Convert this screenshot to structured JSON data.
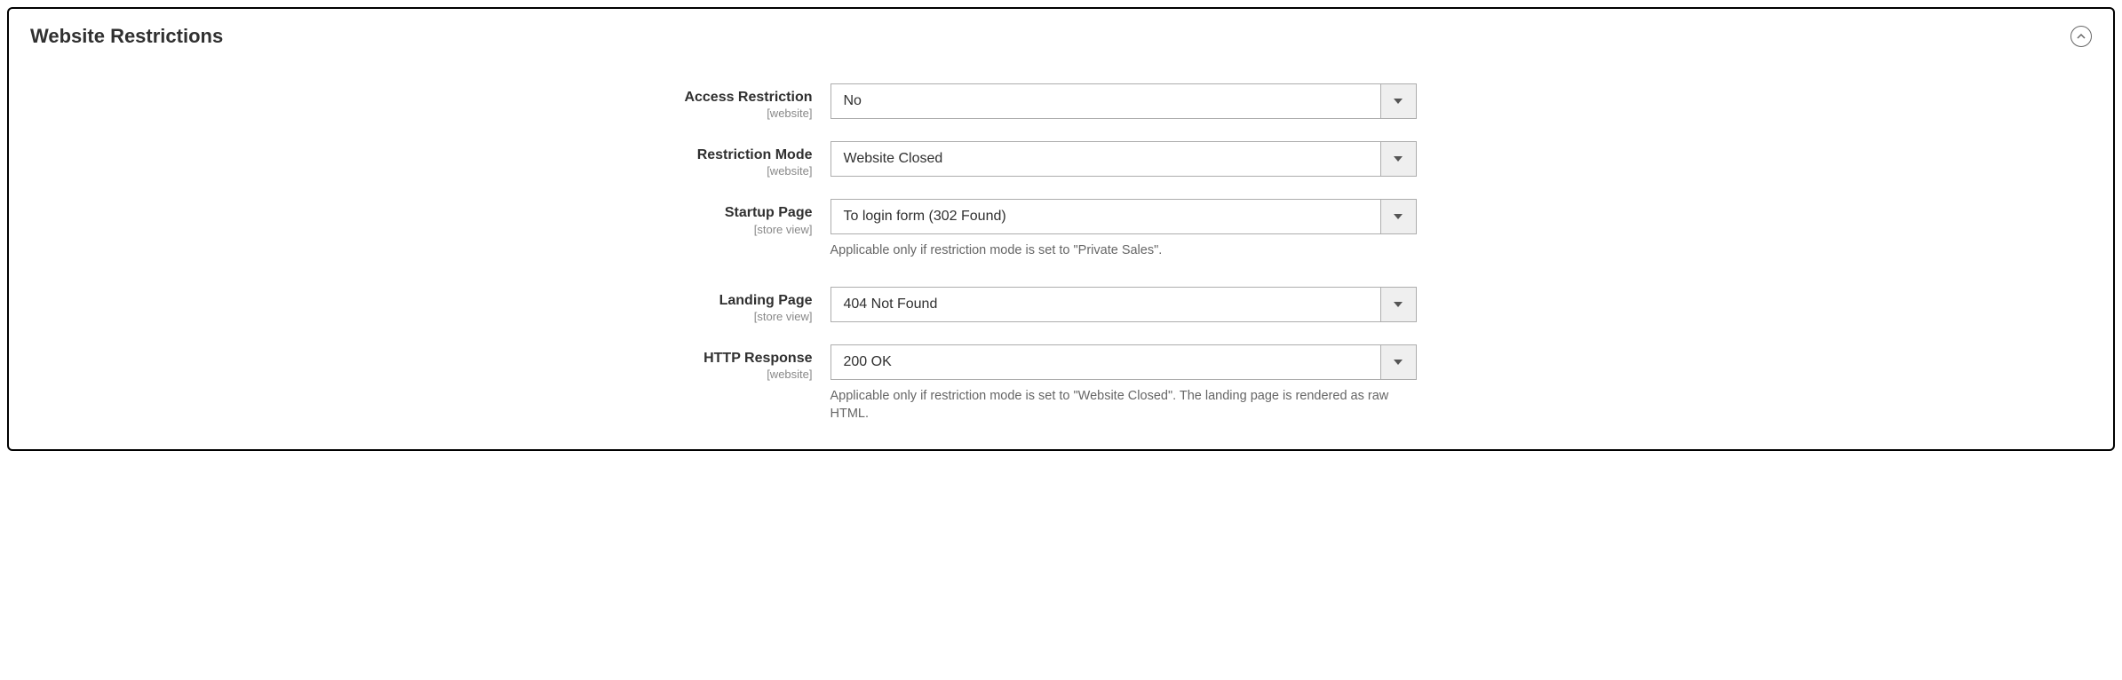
{
  "panel": {
    "title": "Website Restrictions"
  },
  "fields": {
    "access_restriction": {
      "label": "Access Restriction",
      "scope": "[website]",
      "value": "No"
    },
    "restriction_mode": {
      "label": "Restriction Mode",
      "scope": "[website]",
      "value": "Website Closed"
    },
    "startup_page": {
      "label": "Startup Page",
      "scope": "[store view]",
      "value": "To login form (302 Found)",
      "help": "Applicable only if restriction mode is set to \"Private Sales\"."
    },
    "landing_page": {
      "label": "Landing Page",
      "scope": "[store view]",
      "value": "404 Not Found"
    },
    "http_response": {
      "label": "HTTP Response",
      "scope": "[website]",
      "value": "200 OK",
      "help": "Applicable only if restriction mode is set to \"Website Closed\". The landing page is rendered as raw HTML."
    }
  }
}
